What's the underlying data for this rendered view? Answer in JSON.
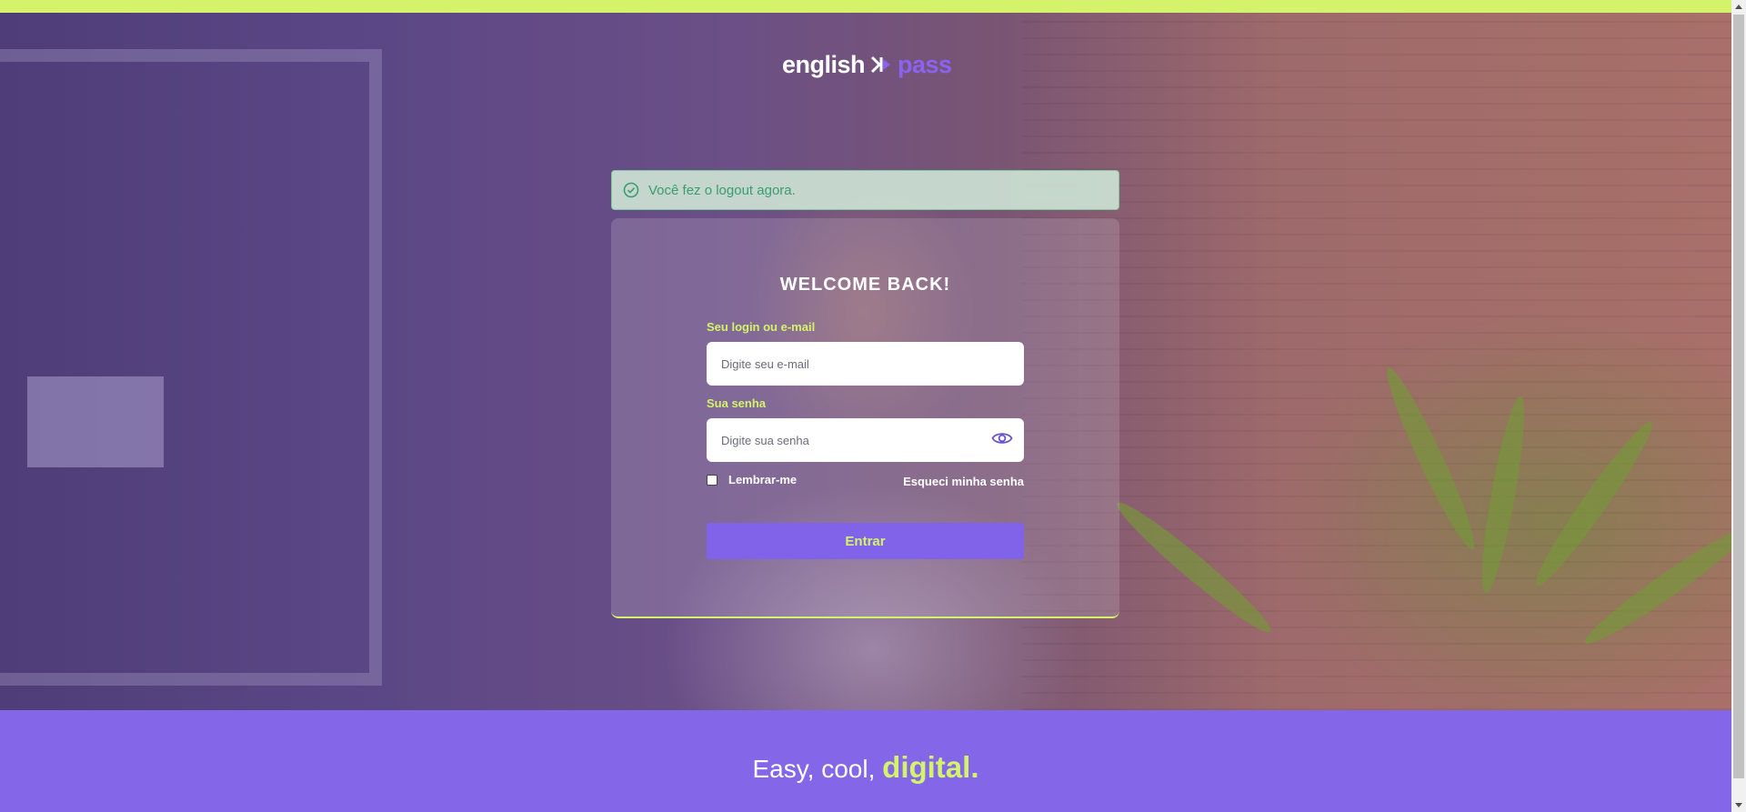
{
  "brand": {
    "name_part1": "english",
    "name_part2": "pass"
  },
  "alert": {
    "message": "Você fez o logout agora.",
    "icon": "check-circle-icon"
  },
  "login": {
    "title": "WELCOME BACK!",
    "email_label": "Seu login ou e-mail",
    "email_placeholder": "Digite seu e-mail",
    "email_value": "",
    "password_label": "Sua senha",
    "password_placeholder": "Digite sua senha",
    "password_value": "",
    "remember_label": "Lembrar-me",
    "remember_checked": false,
    "forgot_label": "Esqueci minha senha",
    "submit_label": "Entrar"
  },
  "footer": {
    "tagline_part1": "Easy, cool, ",
    "tagline_part2": "digital."
  },
  "colors": {
    "accent_lime": "#d4f26a",
    "brand_purple": "#8163e9",
    "success_green": "#3a9d6e"
  }
}
